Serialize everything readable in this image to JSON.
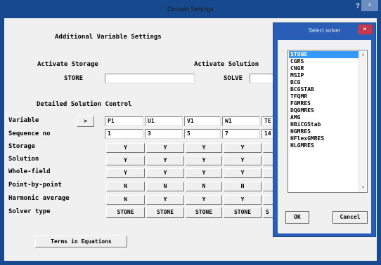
{
  "window": {
    "title": "Domain Settings",
    "help": "?",
    "close": "×"
  },
  "main": {
    "heading": "Additional Variable Settings",
    "activate_storage": "Activate Storage",
    "activate_solution": "Activate Solution",
    "store_label": "STORE",
    "store_value": "",
    "solve_label": "SOLVE",
    "solve_value": "",
    "detailed": "Detailed Solution Control",
    "variable_label": "Variable",
    "next_button": ">",
    "variables": [
      "P1",
      "U1",
      "V1",
      "W1",
      "TE"
    ],
    "sequence_label": "Sequence no",
    "sequence": [
      "1",
      "3",
      "5",
      "7",
      "14"
    ],
    "rows": [
      {
        "label": "Storage",
        "values": [
          "Y",
          "Y",
          "Y",
          "Y"
        ]
      },
      {
        "label": "Solution",
        "values": [
          "Y",
          "Y",
          "Y",
          "Y"
        ]
      },
      {
        "label": "Whole-field",
        "values": [
          "Y",
          "Y",
          "Y",
          "Y"
        ]
      },
      {
        "label": "Point-by-point",
        "values": [
          "N",
          "N",
          "N",
          "N"
        ]
      },
      {
        "label": "Harmonic average",
        "values": [
          "N",
          "Y",
          "Y",
          "Y"
        ]
      },
      {
        "label": "Solver type",
        "values": [
          "STONE",
          "STONE",
          "STONE",
          "STONE",
          "S"
        ]
      }
    ],
    "terms_button": "Terms in Equations"
  },
  "solver_dialog": {
    "title": "Select solver",
    "close": "×",
    "options": [
      "STONE",
      "CGRS",
      "CNGR",
      "MSIP",
      "BCG",
      "BCGSTAB",
      "TFQMR",
      "FGMRES",
      "DQGMRES",
      "AMG",
      "HBiCGStab",
      "HGMRES",
      "HFlexGMRES",
      "HLGMRES"
    ],
    "selected": "STONE",
    "ok": "OK",
    "cancel": "Cancel"
  }
}
